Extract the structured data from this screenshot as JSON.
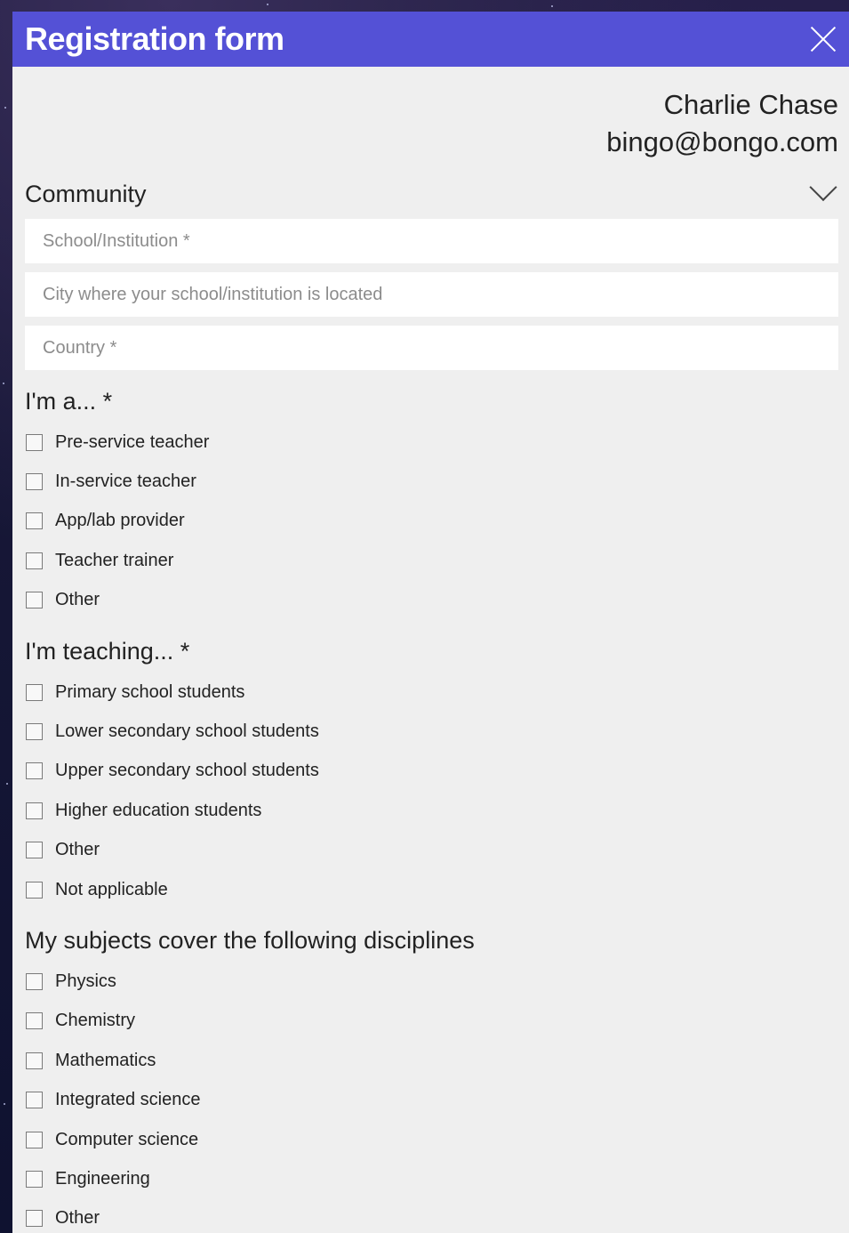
{
  "header": {
    "title": "Registration form"
  },
  "user": {
    "name": "Charlie Chase",
    "email": "bingo@bongo.com"
  },
  "community": {
    "title": "Community",
    "fields": [
      {
        "placeholder": "School/Institution *"
      },
      {
        "placeholder": "City where your school/institution is located"
      },
      {
        "placeholder": "Country *"
      }
    ]
  },
  "role": {
    "title": "I'm a... *",
    "options": [
      "Pre-service teacher",
      "In-service teacher",
      "App/lab provider",
      "Teacher trainer",
      "Other"
    ]
  },
  "teaching": {
    "title": "I'm teaching... *",
    "options": [
      "Primary school students",
      "Lower secondary school students",
      "Upper secondary school students",
      "Higher education students",
      "Other",
      "Not applicable"
    ]
  },
  "disciplines": {
    "title": "My subjects cover the following disciplines",
    "options": [
      "Physics",
      "Chemistry",
      "Mathematics",
      "Integrated science",
      "Computer science",
      "Engineering",
      "Other"
    ]
  }
}
